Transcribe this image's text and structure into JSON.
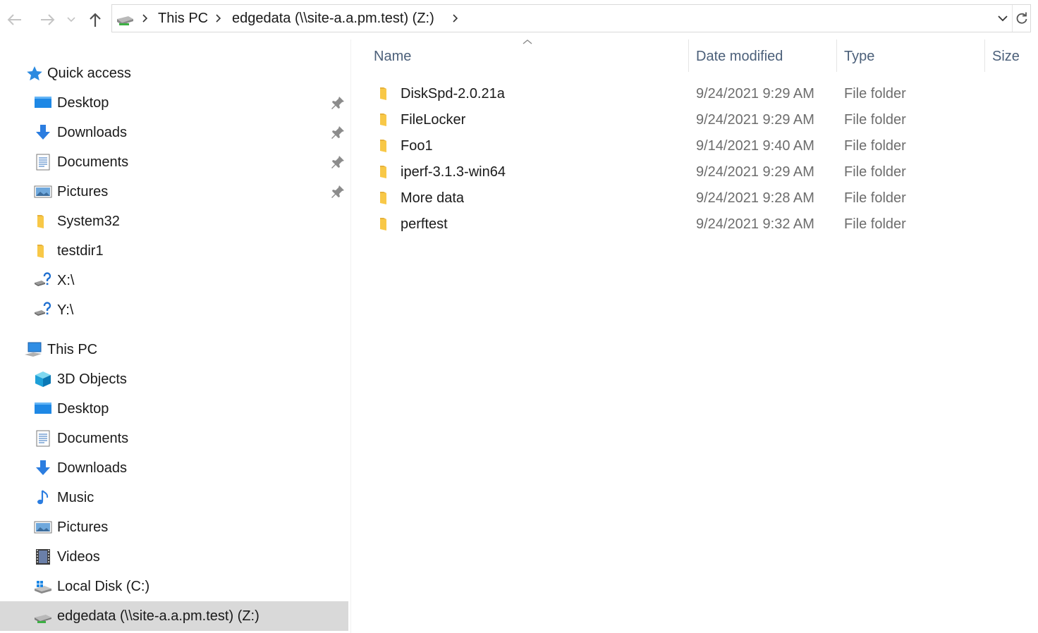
{
  "toolbar": {
    "back_icon": "arrow-left-icon",
    "forward_icon": "arrow-right-icon",
    "recent_icon": "chevron-down-icon",
    "up_icon": "arrow-up-icon"
  },
  "address": {
    "icon": "network-drive-icon",
    "crumbs": [
      "This PC",
      "edgedata (\\\\site-a.a.pm.test) (Z:)"
    ],
    "dropdown_icon": "chevron-down-icon",
    "refresh_icon": "refresh-icon"
  },
  "nav": {
    "quick_access": {
      "label": "Quick access",
      "items": [
        {
          "label": "Desktop",
          "icon": "desktop-icon",
          "pinned": true
        },
        {
          "label": "Downloads",
          "icon": "download-arrow-icon",
          "pinned": true
        },
        {
          "label": "Documents",
          "icon": "document-icon",
          "pinned": true
        },
        {
          "label": "Pictures",
          "icon": "pictures-icon",
          "pinned": true
        },
        {
          "label": "System32",
          "icon": "folder-icon",
          "pinned": false
        },
        {
          "label": "testdir1",
          "icon": "folder-icon",
          "pinned": false
        },
        {
          "label": "X:\\",
          "icon": "disconnected-drive-icon",
          "pinned": false
        },
        {
          "label": "Y:\\",
          "icon": "disconnected-drive-icon",
          "pinned": false
        }
      ]
    },
    "this_pc": {
      "label": "This PC",
      "items": [
        {
          "label": "3D Objects",
          "icon": "3d-objects-icon"
        },
        {
          "label": "Desktop",
          "icon": "desktop-icon"
        },
        {
          "label": "Documents",
          "icon": "document-icon"
        },
        {
          "label": "Downloads",
          "icon": "download-arrow-icon"
        },
        {
          "label": "Music",
          "icon": "music-note-icon"
        },
        {
          "label": "Pictures",
          "icon": "pictures-icon"
        },
        {
          "label": "Videos",
          "icon": "videos-icon"
        },
        {
          "label": "Local Disk (C:)",
          "icon": "local-disk-icon"
        },
        {
          "label": "edgedata (\\\\site-a.a.pm.test) (Z:)",
          "icon": "network-drive-icon",
          "selected": true
        }
      ]
    }
  },
  "columns": {
    "name": "Name",
    "date": "Date modified",
    "type": "Type",
    "size": "Size"
  },
  "files": [
    {
      "name": "DiskSpd-2.0.21a",
      "date": "9/24/2021 9:29 AM",
      "type": "File folder"
    },
    {
      "name": "FileLocker",
      "date": "9/24/2021 9:29 AM",
      "type": "File folder"
    },
    {
      "name": "Foo1",
      "date": "9/14/2021 9:40 AM",
      "type": "File folder"
    },
    {
      "name": "iperf-3.1.3-win64",
      "date": "9/24/2021 9:29 AM",
      "type": "File folder"
    },
    {
      "name": "More data",
      "date": "9/24/2021 9:28 AM",
      "type": "File folder"
    },
    {
      "name": "perftest",
      "date": "9/24/2021 9:32 AM",
      "type": "File folder"
    }
  ],
  "colors": {
    "selection": "#d9d9d9",
    "header_text": "#4c607a",
    "folder": "#f8c847",
    "accent": "#1e88e5"
  }
}
